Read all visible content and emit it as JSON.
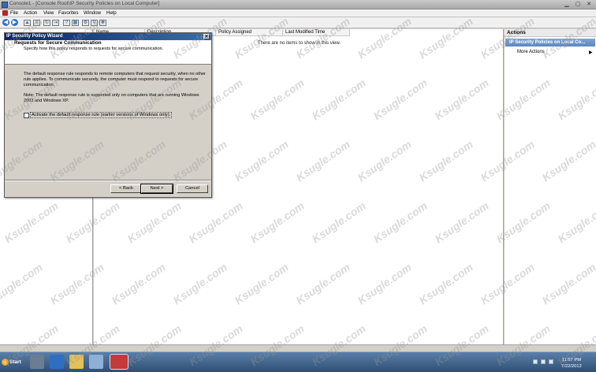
{
  "window": {
    "title": "Console1 - [Console Root\\IP Security Policies on Local Computer]"
  },
  "menu": [
    "File",
    "Action",
    "View",
    "Favorites",
    "Window",
    "Help"
  ],
  "list": {
    "columns": [
      "Name",
      "Description",
      "Policy Assigned",
      "Last Modified Time"
    ],
    "empty_message": "There are no items to show in this view."
  },
  "actions": {
    "header": "Actions",
    "selected": "IP Security Policies on Local Co...",
    "more": "More Actions"
  },
  "dialog": {
    "title": "IP Security Policy Wizard",
    "heading": "Requests for Secure Communication",
    "subheading": "Specify how this policy responds to requests for secure communication.",
    "paragraph1": "The default response rule responds to remote computers that request security, when no other rule applies. To communicate securely, the computer must respond to requests for secure communication.",
    "paragraph2": "Note: The default response rule is supported only on computers that are running Windows 2003 and Windows XP.",
    "checkbox_label": "Activate the default response rule (earlier versions of Windows only).",
    "checkbox_checked": false,
    "back_label": "< Back",
    "next_label": "Next >",
    "cancel_label": "Cancel"
  },
  "taskbar": {
    "start_label": "Start",
    "time": "11:57 PM",
    "date": "7/22/2012"
  },
  "watermark": "Ksugle.com",
  "colors": {
    "dialog_title_start": "#0a246a",
    "dialog_title_end": "#3a6ea5",
    "taskbar": "#3b5f88",
    "action_selected": "#6e96cb"
  }
}
